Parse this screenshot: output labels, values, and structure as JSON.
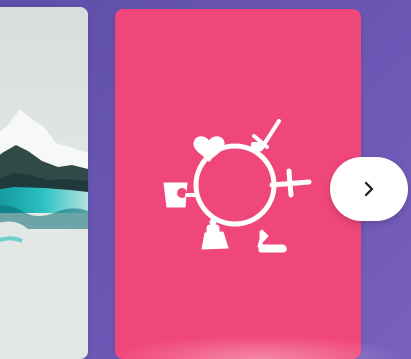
{
  "carousel": {
    "cards": [
      {
        "id": "left-card",
        "icon": "mountain-landscape-image",
        "colors": {
          "sky": "#dfe4e3",
          "snow": "#f6f8f8",
          "ridge": "#2f4a47",
          "water": "#19b8bb"
        }
      },
      {
        "id": "main-card",
        "icon": "life-cycle-icon",
        "colors": {
          "background": "#f0477b",
          "foreground": "#ffffff"
        }
      }
    ],
    "next_button": {
      "icon": "chevron-right-icon",
      "colors": {
        "background": "#ffffff",
        "icon": "#1f1f1f"
      }
    }
  },
  "theme": {
    "background": "#6656b1"
  }
}
